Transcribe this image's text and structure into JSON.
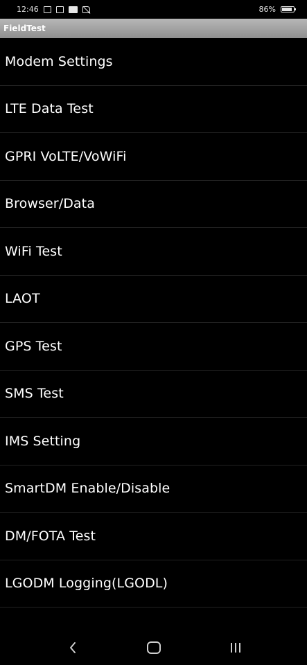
{
  "status_bar": {
    "time": "12:46",
    "battery_percent": "86%",
    "battery_level": 0.86,
    "icons": [
      "gallery-icon",
      "calendar-icon",
      "pulse-icon",
      "no-sim-icon"
    ]
  },
  "app": {
    "title": "FieldTest"
  },
  "menu": {
    "items": [
      {
        "label": "Modem Settings"
      },
      {
        "label": "LTE Data Test"
      },
      {
        "label": "GPRI VoLTE/VoWiFi"
      },
      {
        "label": "Browser/Data"
      },
      {
        "label": "WiFi Test"
      },
      {
        "label": "LAOT"
      },
      {
        "label": "GPS Test"
      },
      {
        "label": "SMS Test"
      },
      {
        "label": "IMS Setting"
      },
      {
        "label": "SmartDM Enable/Disable"
      },
      {
        "label": "DM/FOTA Test"
      },
      {
        "label": "LGODM Logging(LGODL)"
      }
    ]
  },
  "nav": {
    "buttons": [
      "back-icon",
      "home-icon",
      "recents-icon"
    ]
  },
  "colors": {
    "background": "#000000",
    "title_bar": "#a3a3a3",
    "text": "#ffffff",
    "divider": "#222222"
  }
}
